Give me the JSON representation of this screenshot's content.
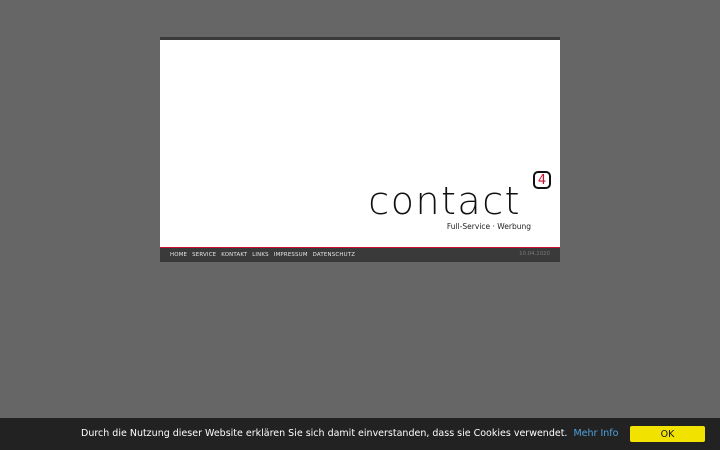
{
  "logo": {
    "word": "contact",
    "badge": "4",
    "tagline": "Full-Service · Werbung"
  },
  "nav": {
    "items": [
      "HOME",
      "SERVICE",
      "KONTAKT",
      "LINKS",
      "IMPRESSUM",
      "DATENSCHUTZ"
    ],
    "date": "10.04.2020"
  },
  "cookie": {
    "text": "Durch die Nutzung dieser Website erklären Sie sich damit einverstanden, dass sie Cookies verwendet.",
    "link_label": "Mehr Info",
    "ok_label": "OK"
  },
  "colors": {
    "accent_red": "#c8102e",
    "button_yellow": "#f2e200",
    "link_blue": "#4fa3e0",
    "page_background": "#666666"
  }
}
